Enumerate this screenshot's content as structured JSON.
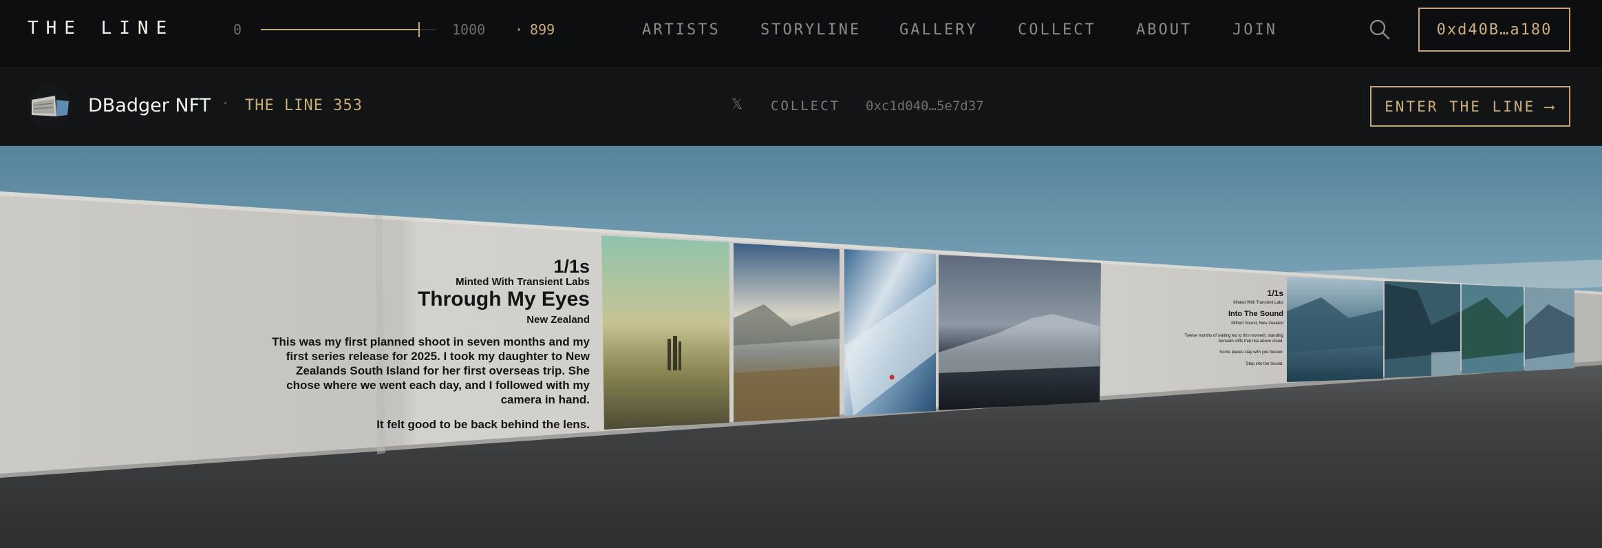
{
  "topnav": {
    "brand": "THE LINE",
    "scale_min": "0",
    "scale_max": "1000",
    "scale_value": "899",
    "scale_fraction": 0.899,
    "items": [
      {
        "label": "ARTISTS"
      },
      {
        "label": "STORYLINE"
      },
      {
        "label": "GALLERY"
      },
      {
        "label": "COLLECT"
      },
      {
        "label": "ABOUT"
      },
      {
        "label": "JOIN"
      }
    ],
    "search_icon": "search-icon",
    "wallet_label": "0xd40B…a180"
  },
  "collection_bar": {
    "name": "DBadger NFT",
    "separator": "·",
    "subtitle": "THE LINE 353",
    "x_icon_glyph": "𝕏",
    "collect_label": "COLLECT",
    "contract": "0xc1d040…5e7d37",
    "enter_label": "ENTER THE LINE",
    "enter_arrow": "⟶"
  },
  "gallery": {
    "panel_main": {
      "edition": "1/1s",
      "minted": "Minted With Transient Labs",
      "title": "Through My Eyes",
      "location": "New Zealand",
      "body_lines": [
        "This was my first planned shoot in seven months and my",
        "first series release for 2025.  I took my daughter to New",
        "Zealands South Island for her first overseas trip. She",
        "chose where we went each day, and I followed with my",
        "camera in hand."
      ],
      "closing": "It felt good to be back behind the lens."
    },
    "panel_second": {
      "edition": "1/1s",
      "minted": "Minted With Transient Labs",
      "title": "Into The Sound",
      "location": "Milford Sound, New Zealand",
      "body_lines": [
        "Twelve months of waiting led to this moment, standing",
        "beneath cliffs that rise above cloud."
      ],
      "line_a": "Some places stay with you forever.",
      "line_b": "Step into the Sound."
    }
  },
  "colors": {
    "accent_gold": "#c4a874",
    "nav_bg": "#0d0e0f",
    "bar_bg": "#121415"
  }
}
